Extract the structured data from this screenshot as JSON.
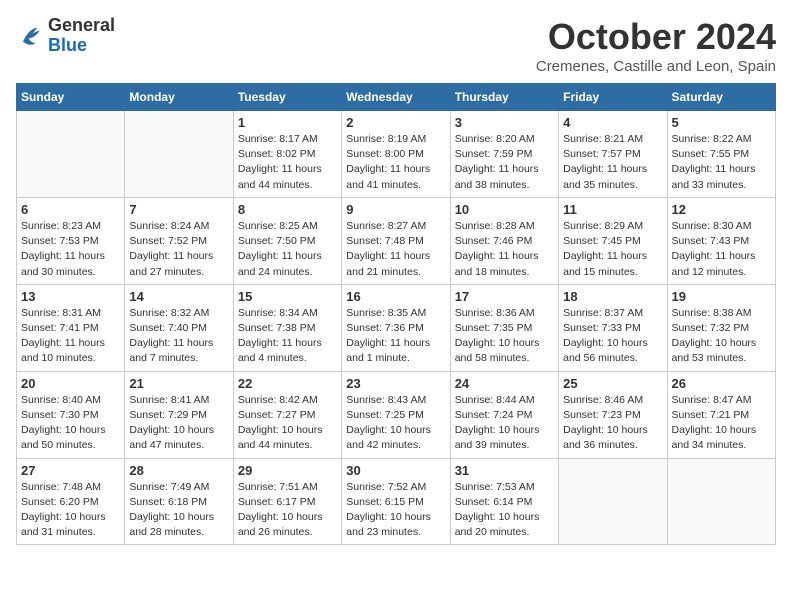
{
  "header": {
    "logo_general": "General",
    "logo_blue": "Blue",
    "month": "October 2024",
    "location": "Cremenes, Castille and Leon, Spain"
  },
  "weekdays": [
    "Sunday",
    "Monday",
    "Tuesday",
    "Wednesday",
    "Thursday",
    "Friday",
    "Saturday"
  ],
  "weeks": [
    [
      {
        "day": "",
        "info": ""
      },
      {
        "day": "",
        "info": ""
      },
      {
        "day": "1",
        "info": "Sunrise: 8:17 AM\nSunset: 8:02 PM\nDaylight: 11 hours and 44 minutes."
      },
      {
        "day": "2",
        "info": "Sunrise: 8:19 AM\nSunset: 8:00 PM\nDaylight: 11 hours and 41 minutes."
      },
      {
        "day": "3",
        "info": "Sunrise: 8:20 AM\nSunset: 7:59 PM\nDaylight: 11 hours and 38 minutes."
      },
      {
        "day": "4",
        "info": "Sunrise: 8:21 AM\nSunset: 7:57 PM\nDaylight: 11 hours and 35 minutes."
      },
      {
        "day": "5",
        "info": "Sunrise: 8:22 AM\nSunset: 7:55 PM\nDaylight: 11 hours and 33 minutes."
      }
    ],
    [
      {
        "day": "6",
        "info": "Sunrise: 8:23 AM\nSunset: 7:53 PM\nDaylight: 11 hours and 30 minutes."
      },
      {
        "day": "7",
        "info": "Sunrise: 8:24 AM\nSunset: 7:52 PM\nDaylight: 11 hours and 27 minutes."
      },
      {
        "day": "8",
        "info": "Sunrise: 8:25 AM\nSunset: 7:50 PM\nDaylight: 11 hours and 24 minutes."
      },
      {
        "day": "9",
        "info": "Sunrise: 8:27 AM\nSunset: 7:48 PM\nDaylight: 11 hours and 21 minutes."
      },
      {
        "day": "10",
        "info": "Sunrise: 8:28 AM\nSunset: 7:46 PM\nDaylight: 11 hours and 18 minutes."
      },
      {
        "day": "11",
        "info": "Sunrise: 8:29 AM\nSunset: 7:45 PM\nDaylight: 11 hours and 15 minutes."
      },
      {
        "day": "12",
        "info": "Sunrise: 8:30 AM\nSunset: 7:43 PM\nDaylight: 11 hours and 12 minutes."
      }
    ],
    [
      {
        "day": "13",
        "info": "Sunrise: 8:31 AM\nSunset: 7:41 PM\nDaylight: 11 hours and 10 minutes."
      },
      {
        "day": "14",
        "info": "Sunrise: 8:32 AM\nSunset: 7:40 PM\nDaylight: 11 hours and 7 minutes."
      },
      {
        "day": "15",
        "info": "Sunrise: 8:34 AM\nSunset: 7:38 PM\nDaylight: 11 hours and 4 minutes."
      },
      {
        "day": "16",
        "info": "Sunrise: 8:35 AM\nSunset: 7:36 PM\nDaylight: 11 hours and 1 minute."
      },
      {
        "day": "17",
        "info": "Sunrise: 8:36 AM\nSunset: 7:35 PM\nDaylight: 10 hours and 58 minutes."
      },
      {
        "day": "18",
        "info": "Sunrise: 8:37 AM\nSunset: 7:33 PM\nDaylight: 10 hours and 56 minutes."
      },
      {
        "day": "19",
        "info": "Sunrise: 8:38 AM\nSunset: 7:32 PM\nDaylight: 10 hours and 53 minutes."
      }
    ],
    [
      {
        "day": "20",
        "info": "Sunrise: 8:40 AM\nSunset: 7:30 PM\nDaylight: 10 hours and 50 minutes."
      },
      {
        "day": "21",
        "info": "Sunrise: 8:41 AM\nSunset: 7:29 PM\nDaylight: 10 hours and 47 minutes."
      },
      {
        "day": "22",
        "info": "Sunrise: 8:42 AM\nSunset: 7:27 PM\nDaylight: 10 hours and 44 minutes."
      },
      {
        "day": "23",
        "info": "Sunrise: 8:43 AM\nSunset: 7:25 PM\nDaylight: 10 hours and 42 minutes."
      },
      {
        "day": "24",
        "info": "Sunrise: 8:44 AM\nSunset: 7:24 PM\nDaylight: 10 hours and 39 minutes."
      },
      {
        "day": "25",
        "info": "Sunrise: 8:46 AM\nSunset: 7:23 PM\nDaylight: 10 hours and 36 minutes."
      },
      {
        "day": "26",
        "info": "Sunrise: 8:47 AM\nSunset: 7:21 PM\nDaylight: 10 hours and 34 minutes."
      }
    ],
    [
      {
        "day": "27",
        "info": "Sunrise: 7:48 AM\nSunset: 6:20 PM\nDaylight: 10 hours and 31 minutes."
      },
      {
        "day": "28",
        "info": "Sunrise: 7:49 AM\nSunset: 6:18 PM\nDaylight: 10 hours and 28 minutes."
      },
      {
        "day": "29",
        "info": "Sunrise: 7:51 AM\nSunset: 6:17 PM\nDaylight: 10 hours and 26 minutes."
      },
      {
        "day": "30",
        "info": "Sunrise: 7:52 AM\nSunset: 6:15 PM\nDaylight: 10 hours and 23 minutes."
      },
      {
        "day": "31",
        "info": "Sunrise: 7:53 AM\nSunset: 6:14 PM\nDaylight: 10 hours and 20 minutes."
      },
      {
        "day": "",
        "info": ""
      },
      {
        "day": "",
        "info": ""
      }
    ]
  ]
}
